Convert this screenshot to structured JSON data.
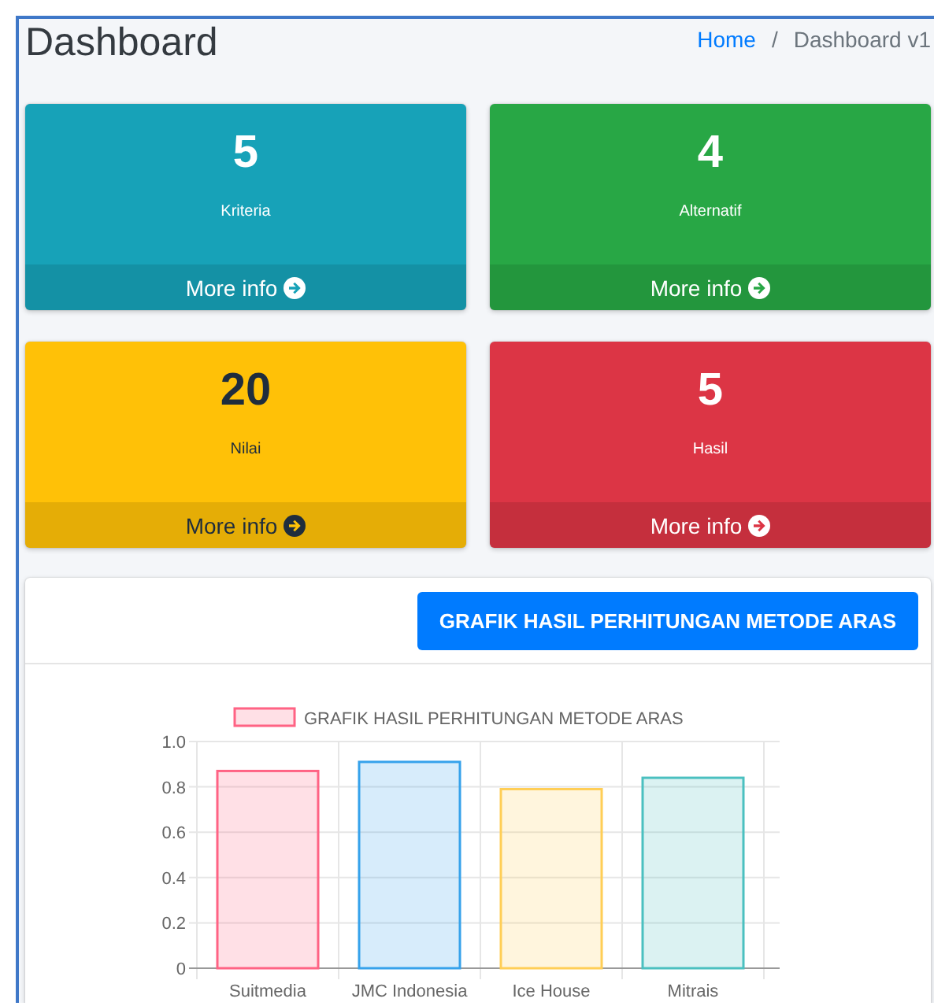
{
  "header": {
    "title": "Dashboard",
    "breadcrumb": [
      {
        "label": "Home",
        "link": true
      },
      {
        "label": "/",
        "link": false
      },
      {
        "label": "Dashboard v1",
        "link": false
      }
    ]
  },
  "stat_cards": [
    {
      "kind": "info",
      "count": "5",
      "label": "Kriteria",
      "footer": "More info"
    },
    {
      "kind": "success",
      "count": "4",
      "label": "Alternatif",
      "footer": "More info"
    },
    {
      "kind": "warning",
      "count": "20",
      "label": "Nilai",
      "footer": "More info"
    },
    {
      "kind": "danger",
      "count": "5",
      "label": "Hasil",
      "footer": "More info"
    }
  ],
  "chart_card": {
    "button": "GRAFIK HASIL PERHITUNGAN METODE ARAS",
    "chart_data": {
      "type": "bar",
      "categories": [
        "Suitmedia",
        "JMC Indonesia",
        "Ice House",
        "Mitrais"
      ],
      "series": [
        {
          "name": "GRAFIK HASIL PERHITUNGAN METODE ARAS",
          "color": "#ff6384",
          "colors": [
            "#ff6384",
            "#36a2eb",
            "#ffce56",
            "#4bc0c0"
          ],
          "values": [
            0.87,
            0.91,
            0.79,
            0.84
          ]
        }
      ],
      "grid": true,
      "ylim": [
        0,
        1
      ],
      "yticks": [
        {
          "value": 0,
          "label": "0"
        },
        {
          "value": 0.2,
          "label": "0.2"
        },
        {
          "value": 0.4,
          "label": "0.4"
        },
        {
          "value": 0.6,
          "label": "0.6"
        },
        {
          "value": 0.8,
          "label": "0.8"
        },
        {
          "value": 1,
          "label": "1.0"
        }
      ]
    }
  }
}
